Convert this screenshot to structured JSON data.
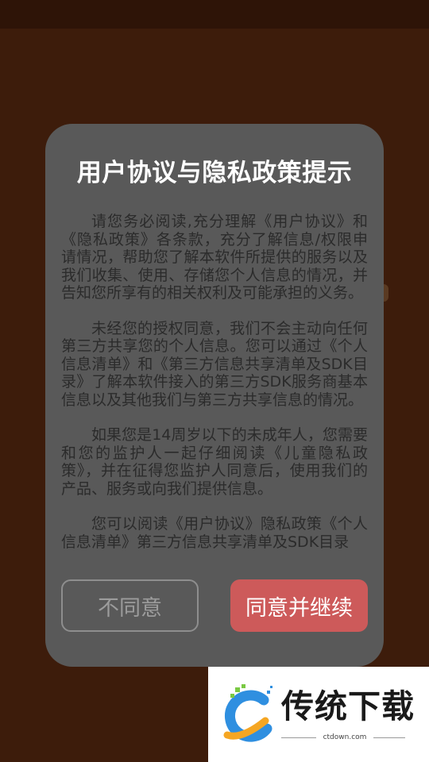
{
  "dialog": {
    "title": "用户协议与隐私政策提示",
    "paragraphs": [
      "请您务必阅读,充分理解《用户协议》和《隐私政策》各条款，充分了解信息/权限申请情况，帮助您了解本软件所提供的服务以及我们收集、使用、存储您个人信息的情况，并告知您所享有的相关权利及可能承担的义务。",
      "未经您的授权同意，我们不会主动向任何第三方共享您的个人信息。您可以通过《个人信息清单》和《第三方信息共享清单及SDK目录》了解本软件接入的第三方SDK服务商基本信息以及其他我们与第三方共享信息的情况。",
      "如果您是14周岁以下的未成年人，您需要和您的监护人一起仔细阅读《儿童隐私政策》，并在征得您监护人同意后，使用我们的产品、服务或向我们提供信息。",
      "您可以阅读《用户协议》隐私政策《个人信息清单》第三方信息共享清单及SDK目录"
    ],
    "disagree_label": "不同意",
    "agree_label": "同意并继续"
  },
  "watermark": {
    "name": "传统下载",
    "url": "ctdown.com"
  },
  "colors": {
    "background": "#3d1c0b",
    "dialog": "#595959",
    "agree_button": "#cd5a5a",
    "logo_blue": "#2f8fe0",
    "logo_orange": "#f5a623"
  }
}
